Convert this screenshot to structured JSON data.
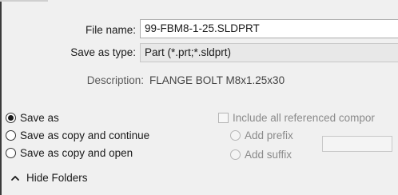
{
  "form": {
    "filename_label": "File name:",
    "filename_value": "99-FBM8-1-25.SLDPRT",
    "savetype_label": "Save as type:",
    "savetype_value": "Part (*.prt;*.sldprt)",
    "description_label": "Description:",
    "description_value": "FLANGE BOLT M8x1.25x30"
  },
  "save_options": {
    "save_as": "Save as",
    "save_as_copy_continue": "Save as copy and continue",
    "save_as_copy_open": "Save as copy and open",
    "selected": "Save as"
  },
  "reference_options": {
    "include_all_label": "Include all referenced compor",
    "add_prefix": "Add prefix",
    "add_suffix": "Add suffix",
    "include_all_checked": false
  },
  "footer": {
    "hide_folders": "Hide Folders",
    "chevron_icon": "chevron-up-icon"
  }
}
